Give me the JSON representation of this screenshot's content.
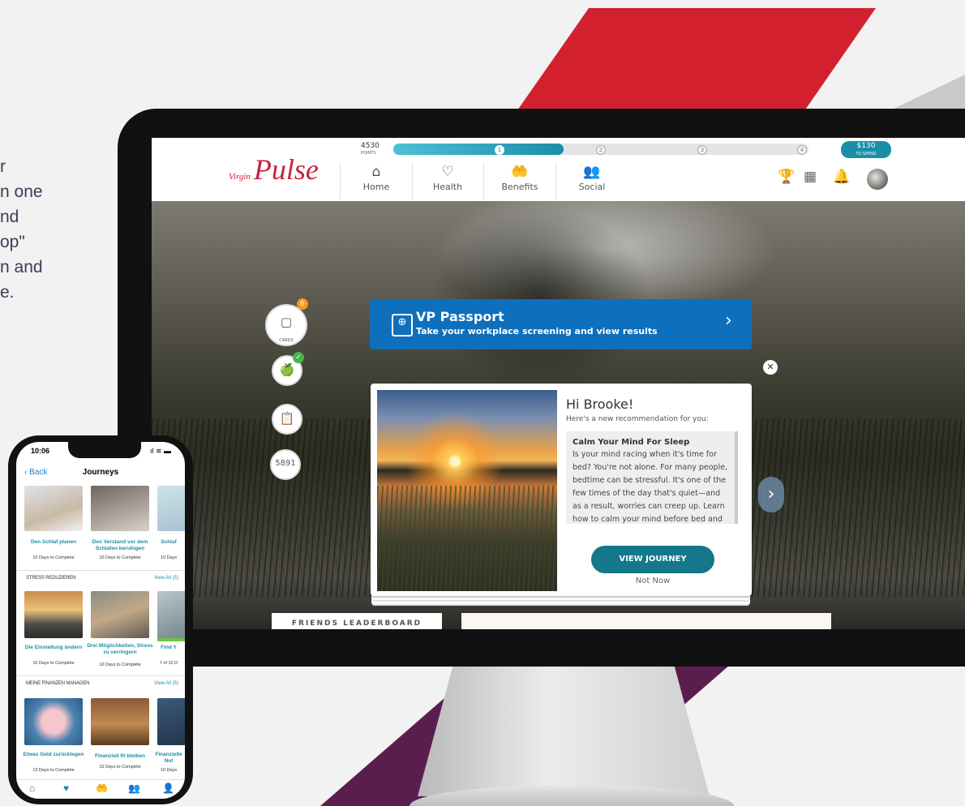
{
  "marketing": {
    "lines": [
      "r",
      "n one",
      "nd",
      "op\"",
      "n and",
      "e."
    ]
  },
  "app": {
    "logo_small": "Virgin",
    "logo": "Pulse",
    "points_value": "4530",
    "points_label": "POINTS",
    "levels": [
      "1",
      "2",
      "3",
      "4"
    ],
    "reward_amount": "$130",
    "reward_label": "TO SPEND",
    "nav": [
      {
        "icon": "⌂",
        "label": "Home"
      },
      {
        "icon": "♡",
        "label": "Health"
      },
      {
        "icon": "🤲",
        "label": "Benefits"
      },
      {
        "icon": "👥",
        "label": "Social"
      }
    ],
    "tool_icons": [
      "trophy-icon",
      "calendar-icon",
      "bell-icon"
    ]
  },
  "passport": {
    "title": "VP Passport",
    "subtitle": "Take your workplace screening and view results"
  },
  "side": {
    "cards_label": "CARDS",
    "cards_count": "6",
    "steps_value": "5891"
  },
  "recommendation": {
    "greeting": "Hi Brooke!",
    "intro": "Here's a new recommendation for you:",
    "title": "Calm Your Mind For Sleep",
    "body": "Is your mind racing when it's time for bed? You're not alone. For many people, bedtime can be stressful. It's one of the few times of the day that's quiet—and as a result, worries can creep up. Learn how to calm your mind before bed and get better rest.",
    "cta": "VIEW JOURNEY",
    "dismiss": "Not Now"
  },
  "leaderboard_title": "FRIENDS LEADERBOARD",
  "phone": {
    "time": "10:06",
    "back": "Back",
    "title": "Journeys",
    "row1": [
      {
        "title": "Den Schlaf planen",
        "sub": "10 Days to Complete"
      },
      {
        "title": "Den Verstand vor dem Schlafen beruhigen",
        "sub": "10 Days to Complete"
      },
      {
        "title": "Schlaf",
        "sub": "10 Days"
      }
    ],
    "section2": {
      "label": "STRESS REDUZIEREN",
      "link": "View All (5)"
    },
    "row2": [
      {
        "title": "Die Einstellung ändern",
        "sub": "10 Days to Complete"
      },
      {
        "title": "Drei Möglichkeiten, Stress zu verringern",
        "sub": "10 Days to Complete"
      },
      {
        "title": "Find Y",
        "sub": "7 of 10 D"
      }
    ],
    "section3": {
      "label": "MEINE FINANZEN MANAGEN",
      "link": "View All (5)"
    },
    "row3": [
      {
        "title": "Etwas Geld zurücklegen",
        "sub": "13 Days to Complete"
      },
      {
        "title": "Finanziell fit bleiben",
        "sub": "15 Days to Complete"
      },
      {
        "title": "Finanzielle Not",
        "sub": "10 Days"
      }
    ]
  }
}
